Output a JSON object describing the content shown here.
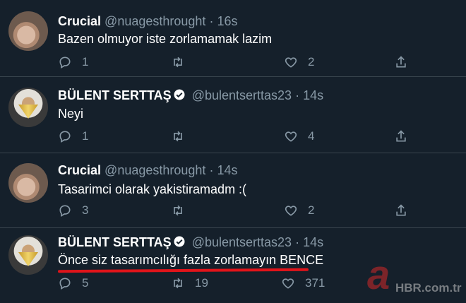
{
  "tweets": [
    {
      "name": "Crucial",
      "handle": "@nuagesthrought",
      "dot": "·",
      "time": "16s",
      "verified": false,
      "text": "Bazen olmuyor iste zorlamamak lazim",
      "replies": "1",
      "retweets": "",
      "likes": "2"
    },
    {
      "name": "BÜLENT SERTTAŞ",
      "handle": "@bulentserttas23",
      "dot": "·",
      "time": "14s",
      "verified": true,
      "text": "Neyi",
      "replies": "1",
      "retweets": "",
      "likes": "4"
    },
    {
      "name": "Crucial",
      "handle": "@nuagesthrought",
      "dot": "·",
      "time": "14s",
      "verified": false,
      "text": "Tasarimci olarak yakistiramadm :(",
      "replies": "3",
      "retweets": "",
      "likes": "2"
    },
    {
      "name": "BÜLENT SERTTAŞ",
      "handle": "@bulentserttas23",
      "dot": "·",
      "time": "14s",
      "verified": true,
      "text": "Önce siz tasarımcılığı fazla zorlamayın BENCE",
      "replies": "5",
      "retweets": "19",
      "likes": "371"
    }
  ],
  "watermark": {
    "logo": "a",
    "text": "HBR.com.tr"
  },
  "colors": {
    "background": "#15202b",
    "secondary": "#8899a6",
    "underline": "#e0141a"
  }
}
